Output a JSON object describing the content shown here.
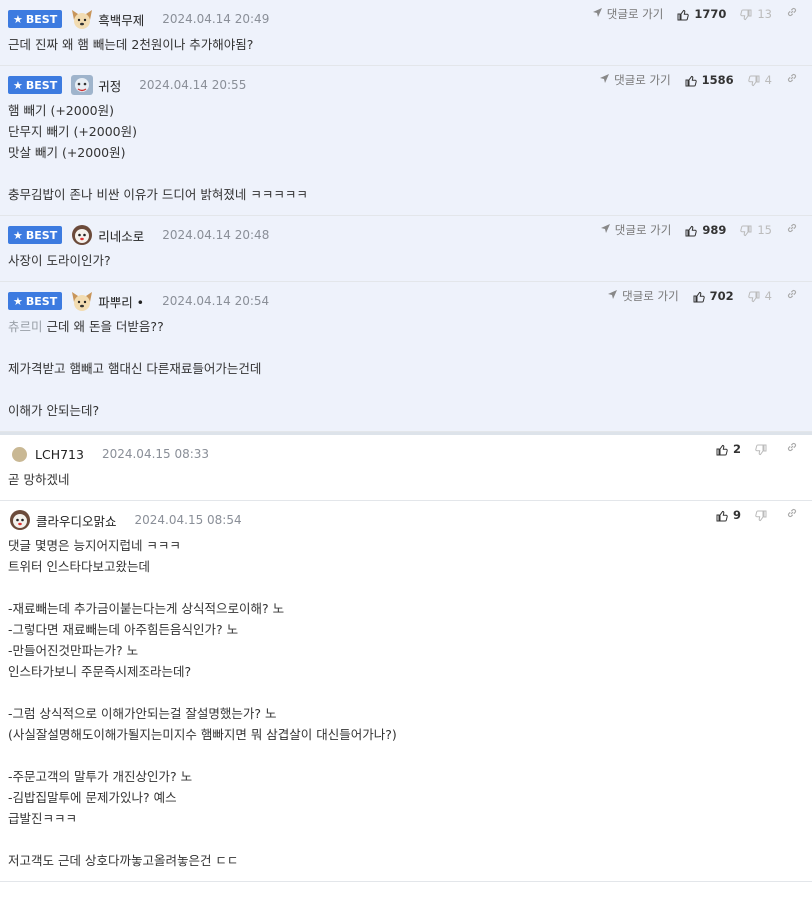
{
  "actions_labels": {
    "reply": "댓글로 가기"
  },
  "comments": [
    {
      "best": true,
      "badge": "BEST",
      "nick": "흑백무제",
      "date": "2024.04.14 20:49",
      "likes": "1770",
      "dislikes": "13",
      "lines": [
        "근데 진짜 왜 햄 빼는데 2천원이나 추가해야됨?"
      ]
    },
    {
      "best": true,
      "badge": "BEST",
      "nick": "귀정",
      "date": "2024.04.14 20:55",
      "likes": "1586",
      "dislikes": "4",
      "lines": [
        "햄 빼기 (+2000원)",
        "단무지 빼기 (+2000원)",
        "맛살 빼기 (+2000원)",
        "",
        "충무김밥이 존나 비싼 이유가 드디어 밝혀졌네 ㅋㅋㅋㅋㅋ"
      ]
    },
    {
      "best": true,
      "badge": "BEST",
      "nick": "리네소로",
      "date": "2024.04.14 20:48",
      "likes": "989",
      "dislikes": "15",
      "lines": [
        "사장이 도라이인가?"
      ]
    },
    {
      "best": true,
      "badge": "BEST",
      "nick": "파뿌리 •",
      "date": "2024.04.14 20:54",
      "likes": "702",
      "dislikes": "4",
      "mention": "츄르미",
      "lines": [
        "근데 왜 돈을 더받음??",
        "",
        "제가격받고 햄빼고 햄대신 다른재료들어가는건데",
        "",
        "이해가 안되는데?"
      ]
    },
    {
      "best": false,
      "nick": "LCH713",
      "date": "2024.04.15 08:33",
      "likes": "2",
      "lines": [
        "곧 망하겠네"
      ]
    },
    {
      "best": false,
      "nick": "클라우디오맑쇼",
      "date": "2024.04.15 08:54",
      "likes": "9",
      "lines": [
        "댓글 몇명은 능지어지럽네 ㅋㅋㅋ",
        "트위터 인스타다보고왔는데",
        "",
        "-재료빼는데 추가금이붙는다는게 상식적으로이해? 노",
        "-그렇다면 재료빼는데 아주힘든음식인가? 노",
        "-만들어진것만파는가? 노",
        "인스타가보니 주문즉시제조라는데?",
        "",
        "-그럼 상식적으로 이해가안되는걸 잘설명했는가? 노",
        "(사실잘설명해도이해가될지는미지수 햄빠지면 뭐 삼겹살이 대신들어가나?)",
        "",
        "-주문고객의 말투가 개진상인가? 노",
        "-김밥집말투에 문제가있나? 예스",
        "급발진ㅋㅋㅋ",
        "",
        "저고객도 근데 상호다까놓고올려놓은건 ㄷㄷ"
      ]
    }
  ],
  "colors": {
    "best_badge": "#3d7be0",
    "best_bg": "#eef2fb"
  },
  "icons": {
    "star": "star-icon",
    "reply": "reply-arrow-icon",
    "like": "thumbs-up-icon",
    "dislike": "thumbs-down-icon",
    "link": "link-icon"
  }
}
